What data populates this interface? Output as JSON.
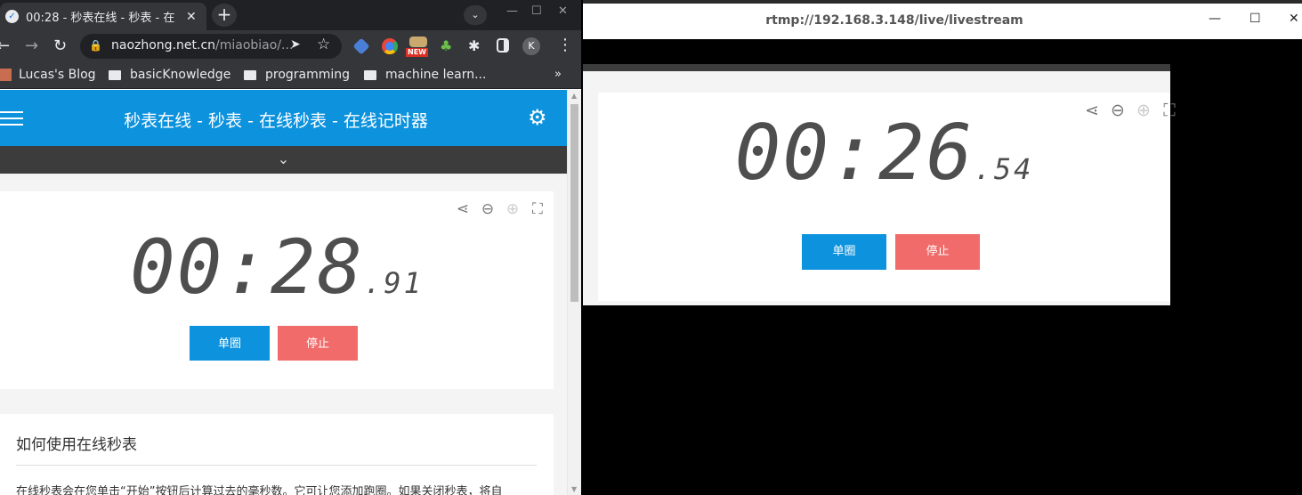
{
  "browser": {
    "tab_title": "00:28 - 秒表在线 - 秒表 - 在",
    "tab_favicon": "clock-favicon",
    "url_domain": "naozhong.net.cn",
    "url_path": "/miaobiao/...",
    "new_badge": "NEW",
    "profile_initial": "K",
    "bookmarks": [
      "Lucas's Blog",
      "basicKnowledge",
      "programming",
      "machine learn..."
    ],
    "bookmarks_more": "»"
  },
  "page": {
    "site_title": "秒表在线 - 秒表 - 在线秒表 - 在线记时器",
    "timer": {
      "main": "00:28",
      "ms": ".91"
    },
    "lap_button": "单圈",
    "stop_button": "停止",
    "article_title": "如何使用在线秒表",
    "article_text": "在线秒表会在您单击“开始”按钮后计算过去的毫秒数。它可让您添加跑圈。如果关闭秒表，将自"
  },
  "player": {
    "window_title": "rtmp://192.168.3.148/live/livestream",
    "timer": {
      "main": "00:26",
      "ms": ".54"
    },
    "lap_button": "单圈",
    "stop_button": "停止"
  },
  "colors": {
    "site_blue": "#0d92dd",
    "stop_red": "#f06b69",
    "digit_gray": "#4e4e4e",
    "chrome_dark": "#35363a"
  },
  "icons": [
    "share-icon",
    "zoom-out-icon",
    "zoom-in-icon",
    "fullscreen-icon",
    "gear-icon",
    "hamburger-icon"
  ]
}
